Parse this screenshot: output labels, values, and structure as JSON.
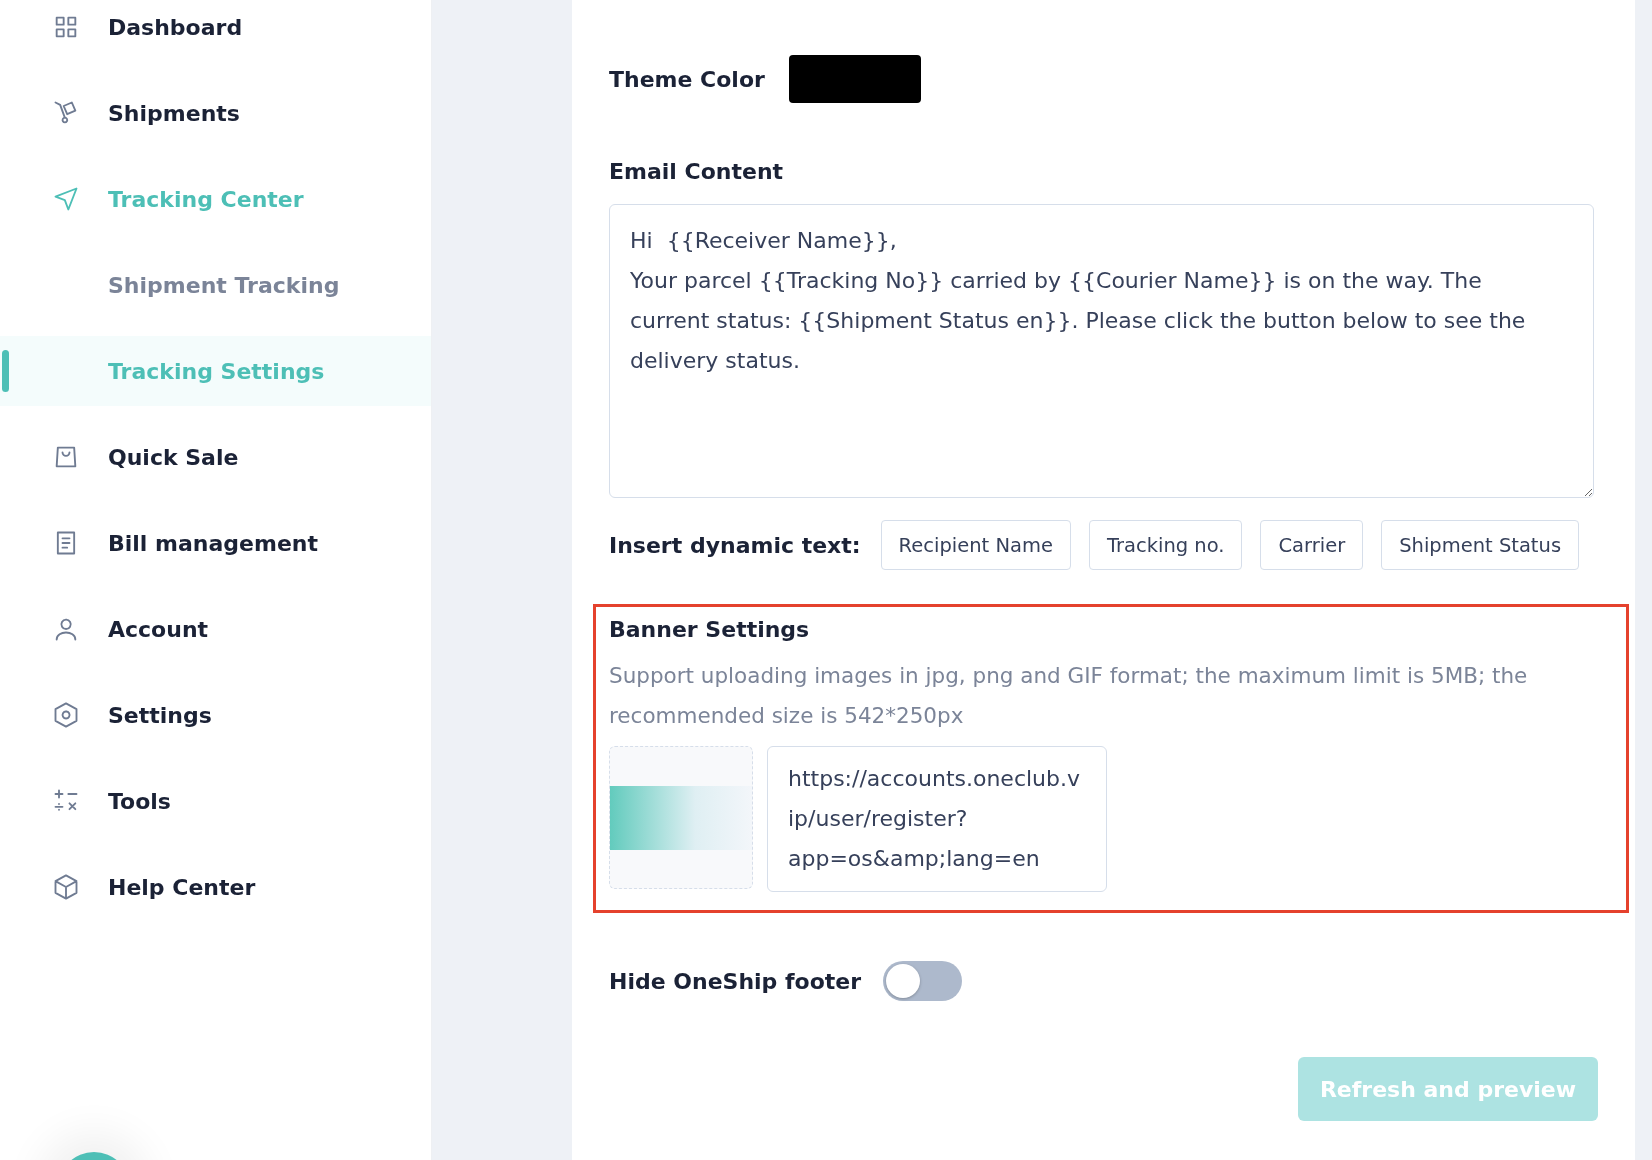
{
  "sidebar": {
    "items": [
      {
        "label": "Dashboard",
        "selected": false
      },
      {
        "label": "Shipments",
        "selected": false
      },
      {
        "label": "Tracking Center",
        "children": [
          {
            "label": "Shipment Tracking",
            "selected": false
          },
          {
            "label": "Tracking Settings",
            "selected": true
          }
        ]
      },
      {
        "label": "Quick Sale",
        "selected": false
      },
      {
        "label": "Bill management",
        "selected": false
      },
      {
        "label": "Account",
        "selected": false
      },
      {
        "label": "Settings",
        "selected": false
      },
      {
        "label": "Tools",
        "selected": false
      },
      {
        "label": "Help Center",
        "selected": false
      }
    ]
  },
  "theme_color": {
    "label": "Theme Color",
    "color": "#000000"
  },
  "email_content": {
    "label": "Email Content",
    "value": "Hi  {{Receiver Name}},\nYour parcel {{Tracking No}} carried by {{Courier Name}} is on the way. The current status: {{Shipment Status en}}. Please click the button below to see the delivery status."
  },
  "dynamic_text": {
    "label": "Insert dynamic text:",
    "buttons": [
      "Recipient Name",
      "Tracking no.",
      "Carrier",
      "Shipment Status"
    ]
  },
  "banner_settings": {
    "title": "Banner Settings",
    "description": "Support uploading images in jpg, png and GIF format; the maximum limit is 5MB; the recommended size is 542*250px",
    "link": "https://accounts.oneclub.vip/user/register?app=os&amp;lang=en"
  },
  "hide_footer": {
    "label": "Hide OneShip footer",
    "on": false
  },
  "preview_button": {
    "label": "Refresh and preview",
    "disabled": true
  }
}
